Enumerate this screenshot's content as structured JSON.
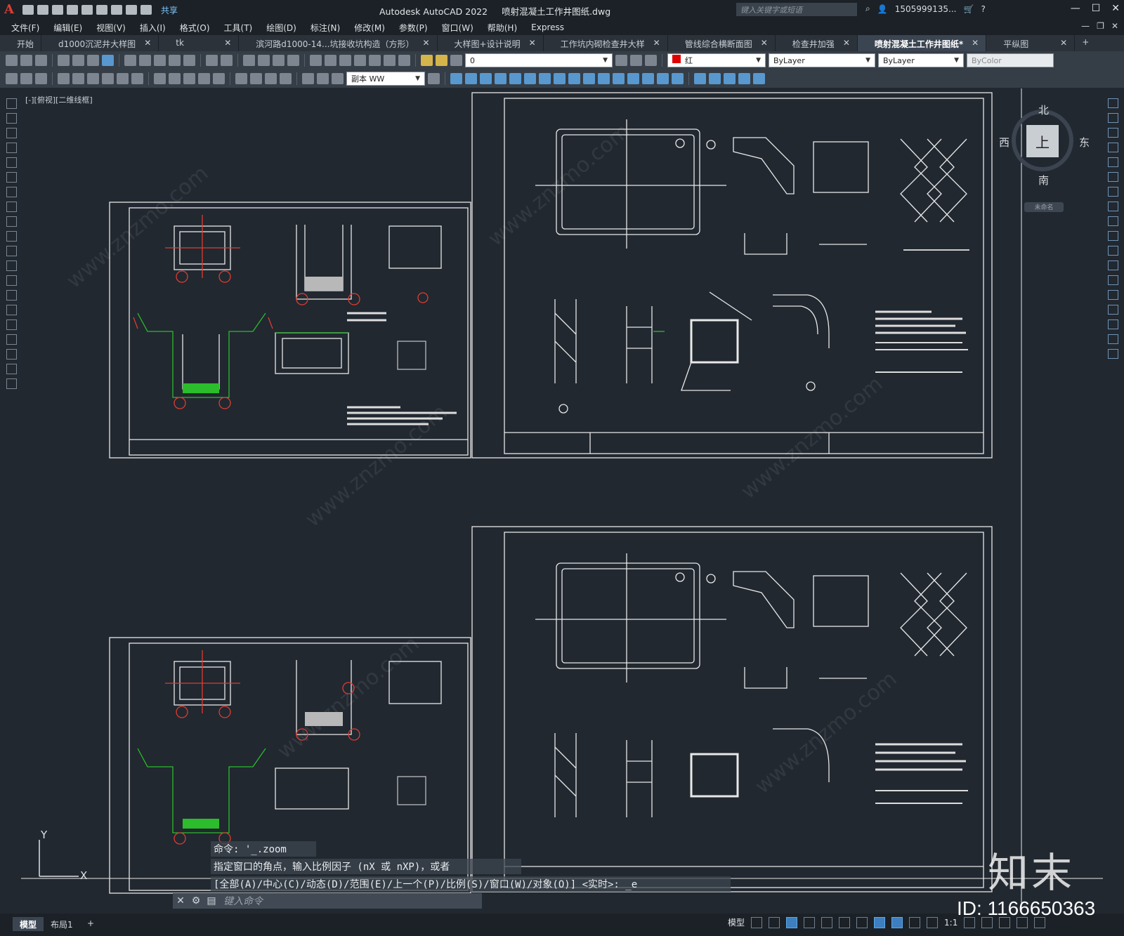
{
  "app": {
    "title": "Autodesk AutoCAD 2022",
    "file": "喷射混凝土工作井图纸.dwg",
    "share": "共享",
    "search_placeholder": "键入关键字或短语",
    "user": "1505999135...",
    "logo": "A"
  },
  "menu": [
    "文件(F)",
    "编辑(E)",
    "视图(V)",
    "插入(I)",
    "格式(O)",
    "工具(T)",
    "绘图(D)",
    "标注(N)",
    "修改(M)",
    "参数(P)",
    "窗口(W)",
    "帮助(H)",
    "Express"
  ],
  "tabs": [
    {
      "label": "开始",
      "close": ""
    },
    {
      "label": "d1000沉泥井大样图",
      "close": "✕"
    },
    {
      "label": "tk",
      "close": "✕"
    },
    {
      "label": "滨河路d1000-14...坑接收坑构造（方形）",
      "close": "✕"
    },
    {
      "label": "大样图+设计说明",
      "close": "✕"
    },
    {
      "label": "工作坑内砌检查井大样",
      "close": "✕"
    },
    {
      "label": "管线综合横断面图",
      "close": "✕"
    },
    {
      "label": "检查井加强",
      "close": "✕"
    },
    {
      "label": "喷射混凝土工作井图纸*",
      "close": "✕"
    },
    {
      "label": "平纵图",
      "close": "✕"
    }
  ],
  "tab_add": "+",
  "properties": {
    "layer": "0",
    "color": "红",
    "linetype": "ByLayer",
    "lineweight": "ByLayer",
    "plotstyle": "ByColor",
    "dimstyle": "副本 WW"
  },
  "viewport_label": "[-][俯视][二维线框]",
  "viewcube": {
    "top": "上",
    "north": "北",
    "south": "南",
    "west": "西",
    "east": "东",
    "wcs": "未命名"
  },
  "ucs": {
    "y": "Y",
    "x": "X"
  },
  "command": {
    "history": [
      "命令: '_.zoom",
      "指定窗口的角点，输入比例因子 (nX 或 nXP)，或者",
      "[全部(A)/中心(C)/动态(D)/范围(E)/上一个(P)/比例(S)/窗口(W)/对象(O)] <实时>: _e"
    ],
    "placeholder": "键入命令"
  },
  "layouts": [
    "模型",
    "布局1"
  ],
  "layout_add": "+",
  "status": {
    "model": "模型",
    "scale": "1:1"
  },
  "watermark": {
    "brand": "知末",
    "id": "ID: 1166650363",
    "site": "www.znzmo.com"
  }
}
